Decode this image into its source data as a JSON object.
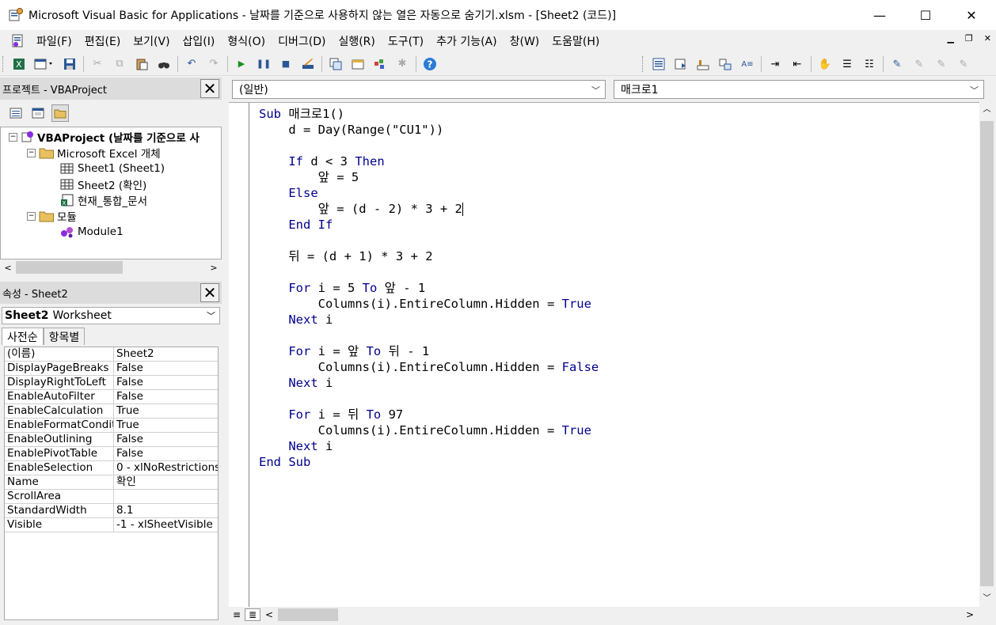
{
  "title": "Microsoft Visual Basic for Applications - 날짜를 기준으로 사용하지 않는 열은 자동으로 숨기기.xlsm - [Sheet2 (코드)]",
  "window_controls": {
    "minimize": "—",
    "maximize": "☐",
    "close": "✕"
  },
  "menu": [
    "파일(F)",
    "편집(E)",
    "보기(V)",
    "삽입(I)",
    "형식(O)",
    "디버그(D)",
    "실행(R)",
    "도구(T)",
    "추가 기능(A)",
    "창(W)",
    "도움말(H)"
  ],
  "project": {
    "title": "프로젝트 - VBAProject",
    "root": "VBAProject (날짜를 기준으로 사",
    "folder_excel": "Microsoft Excel 개체",
    "sheet1": "Sheet1 (Sheet1)",
    "sheet2": "Sheet2 (확인)",
    "thisworkbook": "현재_통합_문서",
    "folder_modules": "모듈",
    "module1": "Module1"
  },
  "properties": {
    "title": "속성 - Sheet2",
    "object_bold": "Sheet2",
    "object_type": "Worksheet",
    "tab_alpha": "사전순",
    "tab_category": "항목별",
    "rows": [
      {
        "name": "(이름)",
        "value": "Sheet2"
      },
      {
        "name": "DisplayPageBreaks",
        "value": "False"
      },
      {
        "name": "DisplayRightToLeft",
        "value": "False"
      },
      {
        "name": "EnableAutoFilter",
        "value": "False"
      },
      {
        "name": "EnableCalculation",
        "value": "True"
      },
      {
        "name": "EnableFormatConditi",
        "value": "True"
      },
      {
        "name": "EnableOutlining",
        "value": "False"
      },
      {
        "name": "EnablePivotTable",
        "value": "False"
      },
      {
        "name": "EnableSelection",
        "value": "0 - xlNoRestrictions"
      },
      {
        "name": "Name",
        "value": "확인"
      },
      {
        "name": "ScrollArea",
        "value": ""
      },
      {
        "name": "StandardWidth",
        "value": "8.1"
      },
      {
        "name": "Visible",
        "value": "-1 - xlSheetVisible"
      }
    ]
  },
  "code": {
    "object_combo": "(일반)",
    "proc_combo": "매크로1",
    "lines": [
      {
        "a": "",
        "k": "Sub",
        "b": " 매크로1()"
      },
      {
        "a": "    d = Day(Range(\"CU1\"))",
        "k": "",
        "b": ""
      },
      {
        "a": "",
        "k": "",
        "b": ""
      },
      {
        "a": "    ",
        "k": "If",
        "b": " d < 3 ",
        "k2": "Then"
      },
      {
        "a": "        앞 = 5",
        "k": "",
        "b": ""
      },
      {
        "a": "    ",
        "k": "Else",
        "b": ""
      },
      {
        "a": "        앞 = (d - 2) * 3 + 2",
        "k": "",
        "b": ""
      },
      {
        "a": "    ",
        "k": "End If",
        "b": ""
      },
      {
        "a": "",
        "k": "",
        "b": ""
      },
      {
        "a": "    뒤 = (d + 1) * 3 + 2",
        "k": "",
        "b": ""
      },
      {
        "a": "",
        "k": "",
        "b": ""
      },
      {
        "a": "    ",
        "k": "For",
        "b": " i = 5 ",
        "k2": "To",
        "c": " 앞 - 1"
      },
      {
        "a": "        Columns(i).EntireColumn.Hidden = ",
        "k": "True",
        "b": ""
      },
      {
        "a": "    ",
        "k": "Next",
        "b": " i"
      },
      {
        "a": "",
        "k": "",
        "b": ""
      },
      {
        "a": "    ",
        "k": "For",
        "b": " i = 앞 ",
        "k2": "To",
        "c": " 뒤 - 1"
      },
      {
        "a": "        Columns(i).EntireColumn.Hidden = ",
        "k": "False",
        "b": ""
      },
      {
        "a": "    ",
        "k": "Next",
        "b": " i"
      },
      {
        "a": "",
        "k": "",
        "b": ""
      },
      {
        "a": "    ",
        "k": "For",
        "b": " i = 뒤 ",
        "k2": "To",
        "c": " 97"
      },
      {
        "a": "        Columns(i).EntireColumn.Hidden = ",
        "k": "True",
        "b": ""
      },
      {
        "a": "    ",
        "k": "Next",
        "b": " i"
      },
      {
        "a": "",
        "k": "End Sub",
        "b": ""
      }
    ]
  },
  "colors": {
    "keyword": "#00008b",
    "pane_title": "#dcdcdc",
    "background": "#f0f0f0"
  }
}
